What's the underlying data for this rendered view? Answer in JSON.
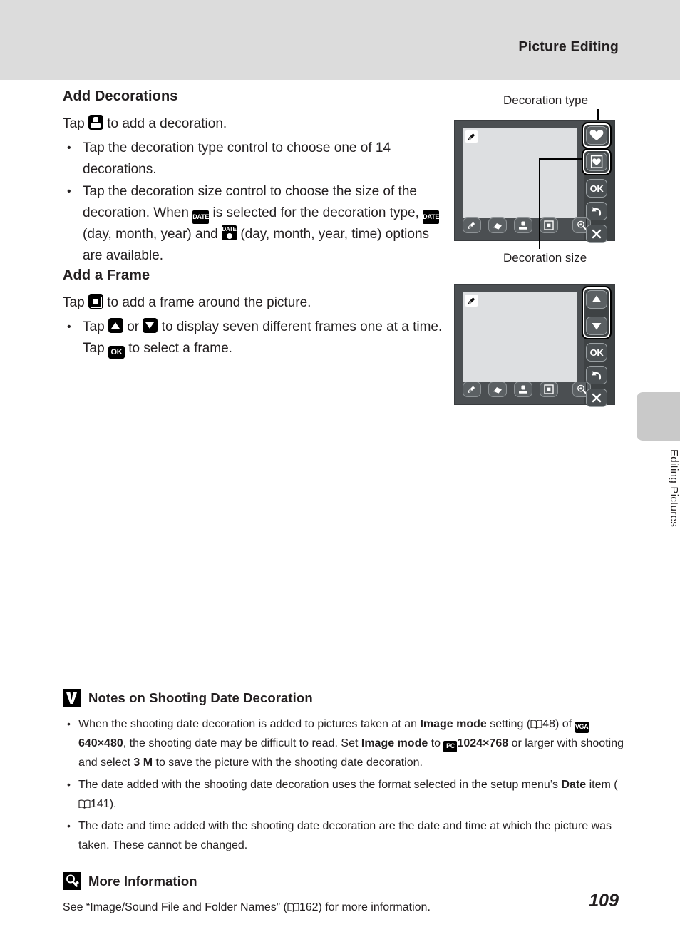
{
  "header": {
    "title": "Picture Editing"
  },
  "side_tab": {
    "label": "Editing Pictures"
  },
  "page_number": "109",
  "sections": {
    "decorations": {
      "heading": "Add Decorations",
      "intro_before": "Tap",
      "intro_after": "to add a decoration.",
      "intro_icon": "stamp-icon",
      "bullet1": "Tap the decoration type control to choose one of 14 decorations.",
      "bullet2_part1": "Tap the decoration size control to choose the size of the decoration. When",
      "bullet2_part2": "is selected for the decoration type,",
      "bullet2_part3": "(day, month, year) and",
      "bullet2_part4": "(day, month, year, time) options are available.",
      "date_icon_label": "DATE",
      "datetime_icon_label": "DATE"
    },
    "frame": {
      "heading": "Add a Frame",
      "intro_before": "Tap",
      "intro_after": "to add a frame around the picture.",
      "intro_icon": "frame-icon",
      "bullet1_part1": "Tap",
      "bullet1_part2": "or",
      "bullet1_part3": "to display seven different frames one at a time. Tap",
      "bullet1_part4": "to select a frame.",
      "ok_icon_label": "OK"
    }
  },
  "callouts": {
    "decoration_type": "Decoration type",
    "decoration_size": "Decoration size"
  },
  "screens": {
    "screen1": {
      "name": "decoration-screen",
      "toolbar_icons": [
        "pencil-icon",
        "eraser-icon",
        "stamp-icon",
        "frame-icon",
        "zoom-icon"
      ],
      "side_buttons": [
        "heart-filled-icon",
        "heart-outline-icon",
        "ok-button",
        "undo-icon",
        "close-icon"
      ],
      "ok_label": "OK"
    },
    "screen2": {
      "name": "frame-screen",
      "toolbar_icons": [
        "pencil-icon",
        "eraser-icon",
        "stamp-icon",
        "frame-icon",
        "zoom-icon"
      ],
      "side_buttons": [
        "arrow-up-icon",
        "arrow-down-icon",
        "ok-button",
        "undo-icon",
        "close-icon"
      ],
      "ok_label": "OK"
    }
  },
  "notes": {
    "heading": "Notes on Shooting Date Decoration",
    "badge": "caution-icon",
    "items": {
      "item1_a": "When the shooting date decoration is added to pictures taken at an",
      "item1_bold1": "Image mode",
      "item1_b": "setting (",
      "item1_ref1": "48",
      "item1_c": ") of",
      "item1_vga": "VGA",
      "item1_bold2": "640×480",
      "item1_d": ", the shooting date may be difficult to read. Set",
      "item1_bold3": "Image mode",
      "item1_e": "to",
      "item1_pc": "PC",
      "item1_bold4": "1024×768",
      "item1_f": "or larger with shooting and select",
      "item1_bold5": "3 M",
      "item1_g": "to save the picture with the shooting date decoration.",
      "item2_a": "The date added with the shooting date decoration uses the format selected in the setup menu’s",
      "item2_bold": "Date",
      "item2_b": "item (",
      "item2_ref": "141",
      "item2_c": ").",
      "item3": "The date and time added with the shooting date decoration are the date and time at which the picture was taken. These cannot be changed."
    }
  },
  "more_info": {
    "heading": "More Information",
    "badge": "magnifier-icon",
    "text_a": "See “Image/Sound File and Folder Names” (",
    "ref": "162",
    "text_b": ") for more information."
  },
  "colors": {
    "header_band": "#dcdcdc",
    "screen_body": "#4b4f52",
    "screen_image": "#dddfe1",
    "text": "#231f20"
  }
}
